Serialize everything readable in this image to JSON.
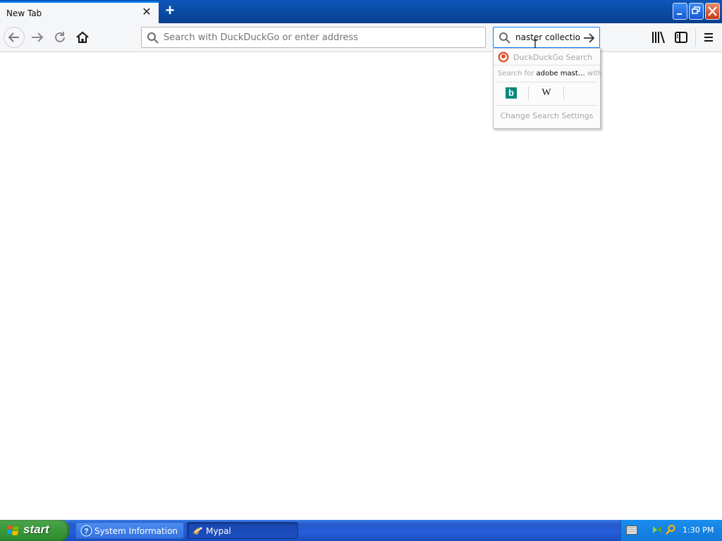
{
  "browser": {
    "tab": {
      "title": "New Tab"
    },
    "urlbar": {
      "placeholder": "Search with DuckDuckGo or enter address",
      "value": ""
    },
    "searchbar": {
      "value": "naster collectio"
    },
    "search_popup": {
      "engine_name": "DuckDuckGo Search",
      "search_for_prefix": "Search for ",
      "search_for_query": "adobe mast…",
      "search_for_suffix": " with",
      "engines": [
        "Bing",
        "Wikipedia"
      ],
      "bing_glyph": "b",
      "wiki_glyph": "W",
      "settings_label": "Change Search Settings"
    },
    "icons": {
      "back": "back-arrow-icon",
      "forward": "forward-arrow-icon",
      "reload": "reload-icon",
      "home": "home-icon",
      "library": "library-icon",
      "sidebar": "sidebar-icon",
      "menu": "hamburger-menu-icon"
    }
  },
  "taskbar": {
    "start_label": "start",
    "tasks": [
      {
        "label": "System Information",
        "active": false
      },
      {
        "label": "Mypal",
        "active": true
      }
    ],
    "clock": "1:30 PM"
  },
  "colors": {
    "accent": "#0a84ff",
    "titlebar": "#0a4ea8",
    "taskbar": "#245edb",
    "start_green": "#3c9a3c",
    "bing_teal": "#00897b"
  }
}
